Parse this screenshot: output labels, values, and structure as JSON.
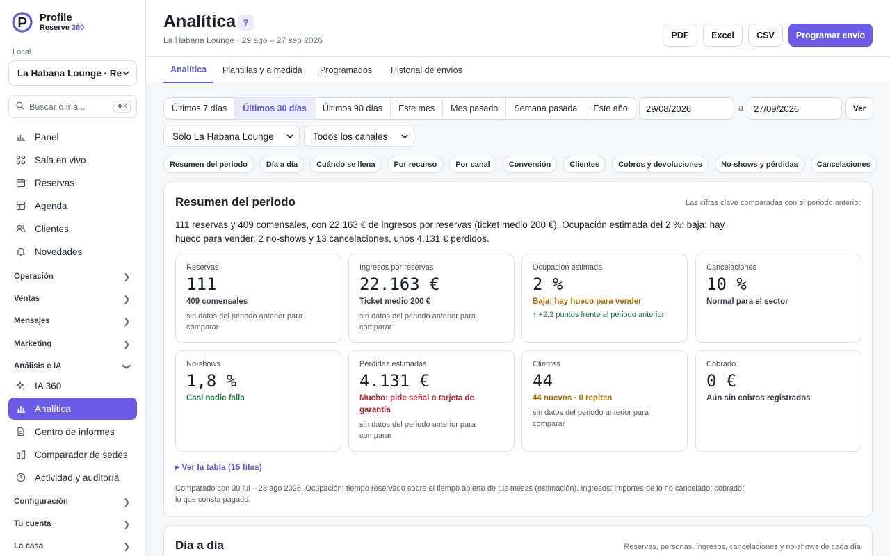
{
  "app": {
    "name": "Profile",
    "sub_prefix": "Reserve ",
    "sub_num": "360"
  },
  "colors": {
    "accent": "#6a5ce6",
    "green": "#1f7a45",
    "amber": "#b26a00",
    "red": "#c0262d"
  },
  "sidebar": {
    "local_label": "Local",
    "local_value": "La Habana Lounge · Rest",
    "search_placeholder": "Buscar o ir a...",
    "search_shortcut": "⌘K",
    "nav": [
      {
        "label": "Panel",
        "icon": "bar-chart-icon"
      },
      {
        "label": "Sala en vivo",
        "icon": "grid-icon"
      },
      {
        "label": "Reservas",
        "icon": "calendar-icon"
      },
      {
        "label": "Agenda",
        "icon": "table-icon"
      },
      {
        "label": "Clientes",
        "icon": "users-icon"
      },
      {
        "label": "Novedades",
        "icon": "bell-icon"
      }
    ],
    "groups": {
      "operacion": "Operación",
      "ventas": "Ventas",
      "mensajes": "Mensajes",
      "marketing": "Marketing",
      "analisis": "Análisis e IA",
      "configuracion": "Configuración",
      "cuenta": "Tu cuenta",
      "casa": "La casa"
    },
    "analisis_items": [
      {
        "label": "IA 360",
        "icon": "sparkle-icon"
      },
      {
        "label": "Analítica",
        "icon": "analytics-icon",
        "active": true
      },
      {
        "label": "Centro de informes",
        "icon": "document-icon"
      },
      {
        "label": "Comparador de sedes",
        "icon": "compare-icon"
      },
      {
        "label": "Actividad y auditoría",
        "icon": "clock-icon"
      }
    ]
  },
  "header": {
    "title": "Analítica",
    "help": "?",
    "subtitle": "La Habana Lounge · 29 ago – 27 sep 2026",
    "buttons": {
      "pdf": "PDF",
      "excel": "Excel",
      "csv": "CSV",
      "schedule": "Programar envío"
    }
  },
  "tabs": [
    "Analítica",
    "Plantillas y a medida",
    "Programados",
    "Historial de envíos"
  ],
  "ranges": [
    "Últimos 7 días",
    "Últimos 30 días",
    "Últimos 90 días",
    "Este mes",
    "Mes pasado",
    "Semana pasada",
    "Este año"
  ],
  "range_selected": "Últimos 30 días",
  "date_from": "29/08/2026",
  "date_sep": "a",
  "date_to": "27/09/2026",
  "view_button": "Ver",
  "filters": {
    "venue": "Sólo La Habana Lounge",
    "channel": "Todos los canales"
  },
  "sections": [
    "Resumen del periodo",
    "Día a día",
    "Cuándo se llena",
    "Por recurso",
    "Por canal",
    "Conversión",
    "Clientes",
    "Cobros y devoluciones",
    "No-shows y pérdidas",
    "Cancelaciones"
  ],
  "summary_card": {
    "title": "Resumen del periodo",
    "note": "Las cifras clave comparadas con el periodo anterior",
    "text": "111 reservas y 409 comensales, con 22.163 € de ingresos por reservas (ticket medio 200 €). Ocupación estimada del 2 %: baja: hay hueco para vender. 2 no-shows y 13 cancelaciones, unos 4.131 € perdidos.",
    "kpis": [
      {
        "label": "Reservas",
        "value": "111",
        "sub": "409 comensales",
        "note": "sin datos del periodo anterior para comparar"
      },
      {
        "label": "Ingresos por reservas",
        "value": "22.163 €",
        "sub": "Ticket medio 200 €",
        "note": "sin datos del periodo anterior para comparar"
      },
      {
        "label": "Ocupación estimada",
        "value": "2 %",
        "sub": "Baja: hay hueco para vender",
        "delta": "↑ +2,2 puntos frente al periodo anterior"
      },
      {
        "label": "Cancelaciones",
        "value": "10 %",
        "sub": "Normal para el sector"
      },
      {
        "label": "No-shows",
        "value": "1,8 %",
        "sub": "Casi nadie falla"
      },
      {
        "label": "Pérdidas estimadas",
        "value": "4.131 €",
        "sub": "Mucho: pide señal o tarjeta de garantía",
        "note": "sin datos del periodo anterior para comparar"
      },
      {
        "label": "Clientes",
        "value": "44",
        "sub": "44 nuevos · 0 repiten",
        "note": "sin datos del periodo anterior para comparar"
      },
      {
        "label": "Cobrado",
        "value": "0 €",
        "sub": "Aún sin cobros registrados"
      }
    ],
    "table_link": "▸ Ver la tabla (15 filas)",
    "footnote": "Comparado con 30 jul – 28 ago 2026. Ocupación: tiempo reservado sobre el tiempo abierto de tus mesas (estimación). Ingresos: importes de lo no cancelado; cobrado: lo que consta pagado."
  },
  "daily_card": {
    "title": "Día a día",
    "note": "Reservas, personas, ingresos, cancelaciones y no-shows de cada día"
  }
}
